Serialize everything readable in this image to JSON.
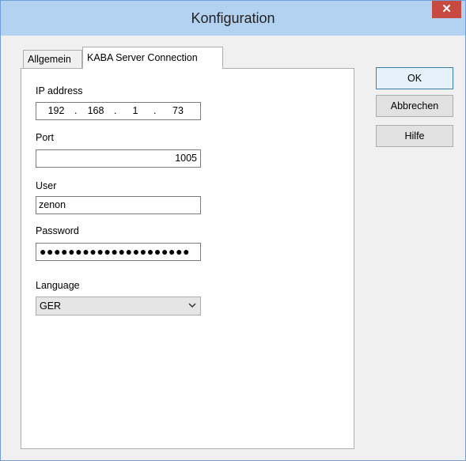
{
  "window": {
    "title": "Konfiguration",
    "close_glyph": "✕"
  },
  "tabs": [
    {
      "label": "Allgemein",
      "active": false
    },
    {
      "label": "KABA Server Connection",
      "active": true
    }
  ],
  "form": {
    "ip_label": "IP address",
    "ip_octets": [
      "192",
      "168",
      "1",
      "73"
    ],
    "ip_separator": ".",
    "port_label": "Port",
    "port_value": "1005",
    "user_label": "User",
    "user_value": "zenon",
    "password_label": "Password",
    "password_mask": "●●●●●●●●●●●●●●●●●●●●●",
    "language_label": "Language",
    "language_value": "GER"
  },
  "buttons": {
    "ok": "OK",
    "cancel": "Abbrechen",
    "help": "Hilfe"
  },
  "icons": {
    "close": "close-icon",
    "dropdown": "chevron-down-icon"
  },
  "colors": {
    "titlebar": "#b3d1f1",
    "close_button": "#c74a40",
    "default_button_border": "#3c7fb1"
  }
}
